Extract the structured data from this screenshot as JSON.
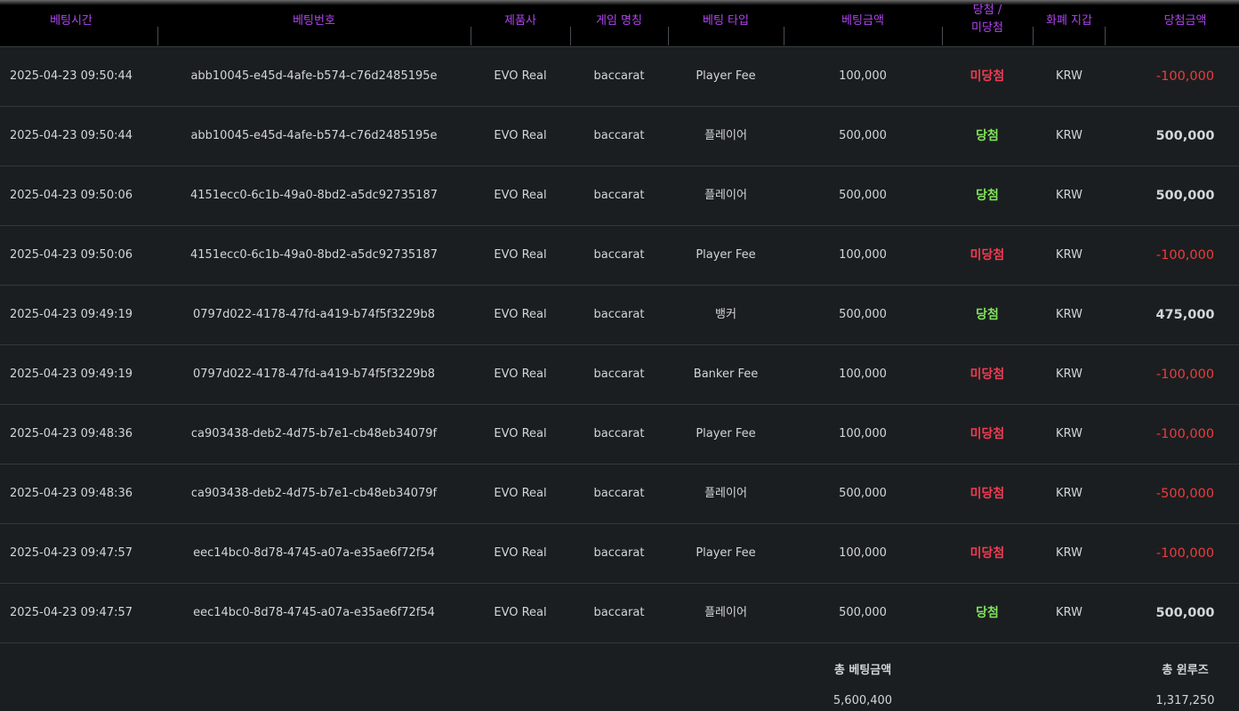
{
  "colors": {
    "header_text": "#b045f0",
    "win": "#7fe35a",
    "lose": "#ef3b52",
    "lose_amount": "#ef3b3b"
  },
  "headers": {
    "time": "베팅시간",
    "bet_id": "베팅번호",
    "product": "제품사",
    "game": "게임 명칭",
    "bet_type": "베팅 타입",
    "bet_amount": "베팅금액",
    "result_1": "당첨 /",
    "result_2": "미당첨",
    "currency": "화폐 지갑",
    "win_amount": "당첨금액"
  },
  "rows": [
    {
      "time": "2025-04-23 09:50:44",
      "bet_id": "abb10045-e45d-4afe-b574-c76d2485195e",
      "product": "EVO Real",
      "game": "baccarat",
      "bet_type": "Player Fee",
      "bet_amount": "100,000",
      "result": "미당첨",
      "result_status": "lose",
      "currency": "KRW",
      "win_amount": "-100,000"
    },
    {
      "time": "2025-04-23 09:50:44",
      "bet_id": "abb10045-e45d-4afe-b574-c76d2485195e",
      "product": "EVO Real",
      "game": "baccarat",
      "bet_type": "플레이어",
      "bet_amount": "500,000",
      "result": "당첨",
      "result_status": "win",
      "currency": "KRW",
      "win_amount": "500,000"
    },
    {
      "time": "2025-04-23 09:50:06",
      "bet_id": "4151ecc0-6c1b-49a0-8bd2-a5dc92735187",
      "product": "EVO Real",
      "game": "baccarat",
      "bet_type": "플레이어",
      "bet_amount": "500,000",
      "result": "당첨",
      "result_status": "win",
      "currency": "KRW",
      "win_amount": "500,000"
    },
    {
      "time": "2025-04-23 09:50:06",
      "bet_id": "4151ecc0-6c1b-49a0-8bd2-a5dc92735187",
      "product": "EVO Real",
      "game": "baccarat",
      "bet_type": "Player Fee",
      "bet_amount": "100,000",
      "result": "미당첨",
      "result_status": "lose",
      "currency": "KRW",
      "win_amount": "-100,000"
    },
    {
      "time": "2025-04-23 09:49:19",
      "bet_id": "0797d022-4178-47fd-a419-b74f5f3229b8",
      "product": "EVO Real",
      "game": "baccarat",
      "bet_type": "뱅커",
      "bet_amount": "500,000",
      "result": "당첨",
      "result_status": "win",
      "currency": "KRW",
      "win_amount": "475,000"
    },
    {
      "time": "2025-04-23 09:49:19",
      "bet_id": "0797d022-4178-47fd-a419-b74f5f3229b8",
      "product": "EVO Real",
      "game": "baccarat",
      "bet_type": "Banker Fee",
      "bet_amount": "100,000",
      "result": "미당첨",
      "result_status": "lose",
      "currency": "KRW",
      "win_amount": "-100,000"
    },
    {
      "time": "2025-04-23 09:48:36",
      "bet_id": "ca903438-deb2-4d75-b7e1-cb48eb34079f",
      "product": "EVO Real",
      "game": "baccarat",
      "bet_type": "Player Fee",
      "bet_amount": "100,000",
      "result": "미당첨",
      "result_status": "lose",
      "currency": "KRW",
      "win_amount": "-100,000"
    },
    {
      "time": "2025-04-23 09:48:36",
      "bet_id": "ca903438-deb2-4d75-b7e1-cb48eb34079f",
      "product": "EVO Real",
      "game": "baccarat",
      "bet_type": "플레이어",
      "bet_amount": "500,000",
      "result": "미당첨",
      "result_status": "lose",
      "currency": "KRW",
      "win_amount": "-500,000"
    },
    {
      "time": "2025-04-23 09:47:57",
      "bet_id": "eec14bc0-8d78-4745-a07a-e35ae6f72f54",
      "product": "EVO Real",
      "game": "baccarat",
      "bet_type": "Player Fee",
      "bet_amount": "100,000",
      "result": "미당첨",
      "result_status": "lose",
      "currency": "KRW",
      "win_amount": "-100,000"
    },
    {
      "time": "2025-04-23 09:47:57",
      "bet_id": "eec14bc0-8d78-4745-a07a-e35ae6f72f54",
      "product": "EVO Real",
      "game": "baccarat",
      "bet_type": "플레이어",
      "bet_amount": "500,000",
      "result": "당첨",
      "result_status": "win",
      "currency": "KRW",
      "win_amount": "500,000"
    }
  ],
  "footer": {
    "total_bet_label": "총 베팅금액",
    "total_bet_value": "5,600,400",
    "total_winlose_label": "총 윈루즈",
    "total_winlose_value": "1,317,250"
  }
}
